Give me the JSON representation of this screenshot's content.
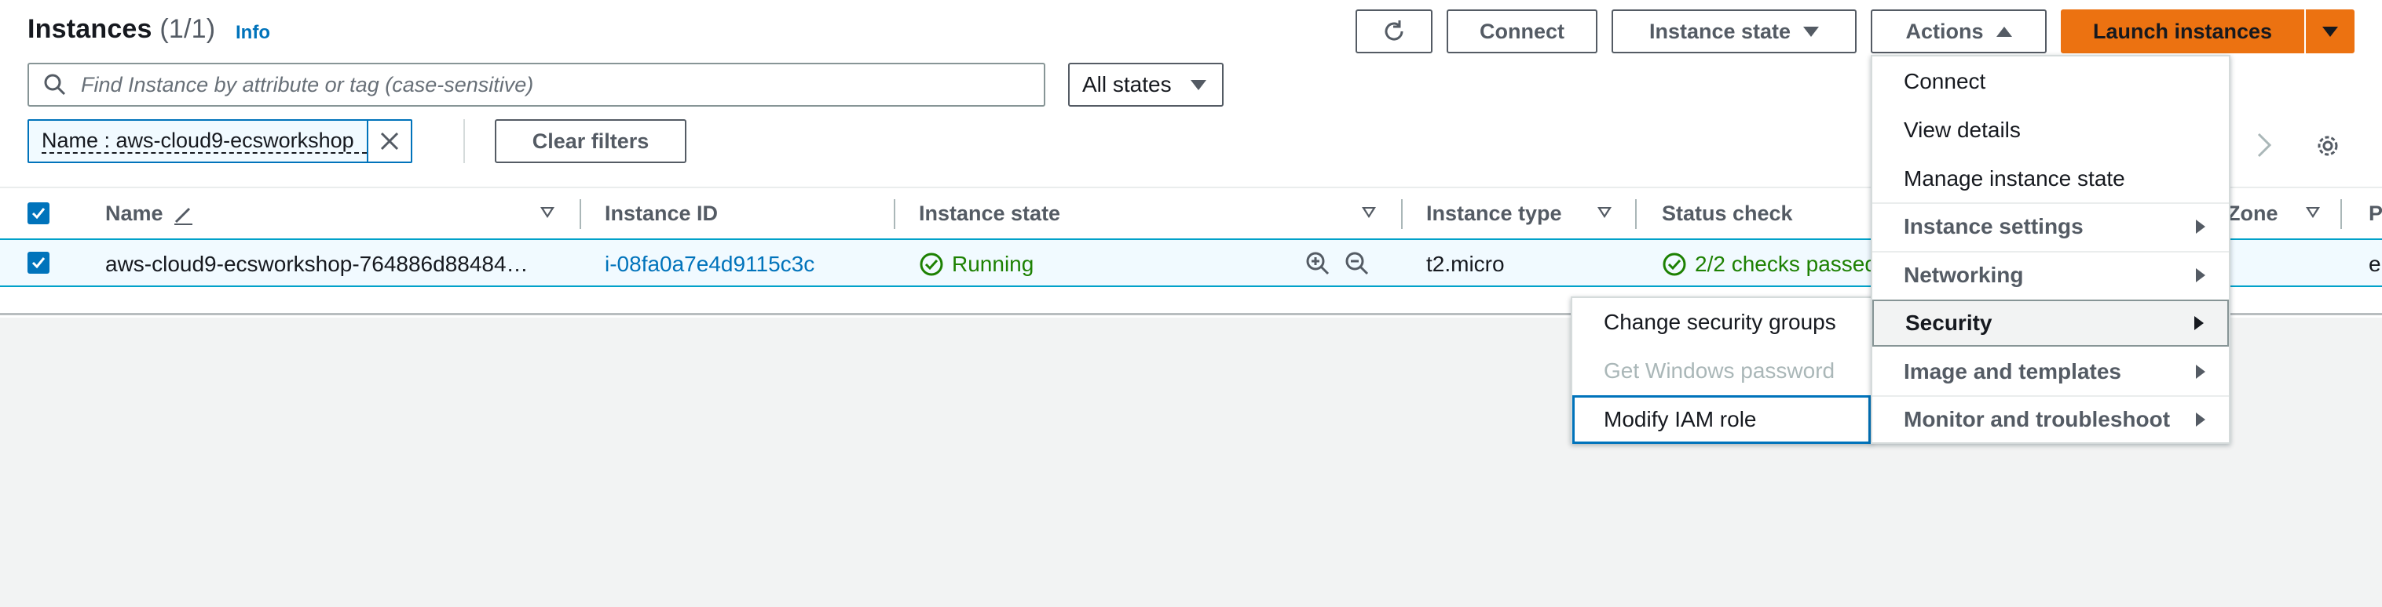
{
  "header": {
    "title": "Instances",
    "count": "(1/1)",
    "info": "Info"
  },
  "toolbar": {
    "connect_label": "Connect",
    "instance_state_label": "Instance state",
    "actions_label": "Actions",
    "launch_label": "Launch instances"
  },
  "search": {
    "placeholder": "Find Instance by attribute or tag (case-sensitive)",
    "value": ""
  },
  "states_filter": {
    "selected": "All states"
  },
  "filter_token": {
    "label": "Name : aws-cloud9-ecsworkshop"
  },
  "clear_filters_label": "Clear filters",
  "table": {
    "columns": [
      "Name",
      "Instance ID",
      "Instance state",
      "Instance type",
      "Status check",
      "Zone",
      "P"
    ],
    "rows": [
      {
        "name": "aws-cloud9-ecsworkshop-764886d88484…",
        "instance_id": "i-08fa0a7e4d9115c3c",
        "state": "Running",
        "type": "t2.micro",
        "status": "2/2 checks passed",
        "last": "e"
      }
    ]
  },
  "actions_menu": {
    "items": [
      {
        "label": "Connect"
      },
      {
        "label": "View details"
      },
      {
        "label": "Manage instance state"
      },
      {
        "label": "Instance settings"
      },
      {
        "label": "Networking"
      },
      {
        "label": "Security"
      },
      {
        "label": "Image and templates"
      },
      {
        "label": "Monitor and troubleshoot"
      }
    ]
  },
  "security_submenu": {
    "items": [
      {
        "label": "Change security groups"
      },
      {
        "label": "Get Windows password"
      },
      {
        "label": "Modify IAM role"
      }
    ]
  },
  "colors": {
    "accent": "#0073bb",
    "launch": "#ec7211",
    "success": "#1d8102"
  }
}
